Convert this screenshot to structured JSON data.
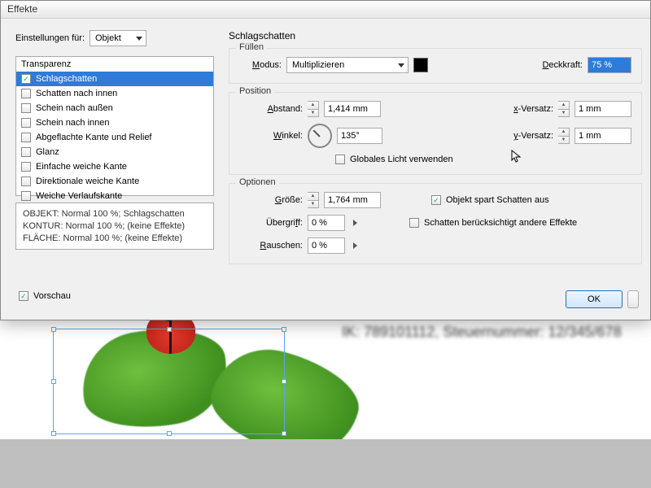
{
  "dialog": {
    "title": "Effekte",
    "settings_for_label": "Einstellungen für:",
    "settings_for_value": "Objekt",
    "effects": [
      {
        "label": "Transparenz",
        "checked": false
      },
      {
        "label": "Schlagschatten",
        "checked": true,
        "selected": true
      },
      {
        "label": "Schatten nach innen",
        "checked": false
      },
      {
        "label": "Schein nach außen",
        "checked": false
      },
      {
        "label": "Schein nach innen",
        "checked": false
      },
      {
        "label": "Abgeflachte Kante und Relief",
        "checked": false
      },
      {
        "label": "Glanz",
        "checked": false
      },
      {
        "label": "Einfache weiche Kante",
        "checked": false
      },
      {
        "label": "Direktionale weiche Kante",
        "checked": false
      },
      {
        "label": "Weiche Verlaufskante",
        "checked": false
      }
    ],
    "summary": {
      "line1": "OBJEKT: Normal 100 %; Schlagschatten",
      "line2": "KONTUR: Normal 100 %; (keine Effekte)",
      "line3": "FLÄCHE: Normal 100 %; (keine Effekte)"
    },
    "right": {
      "heading": "Schlagschatten",
      "fill": {
        "legend": "Füllen",
        "mode_label": "Modus:",
        "mode_value": "Multiplizieren",
        "opacity_label": "Deckkraft:",
        "opacity_value": "75 %"
      },
      "position": {
        "legend": "Position",
        "distance_label": "Abstand:",
        "distance_value": "1,414 mm",
        "angle_label": "Winkel:",
        "angle_value": "135°",
        "xoffset_label": "x-Versatz:",
        "xoffset_value": "1 mm",
        "yoffset_label": "y-Versatz:",
        "yoffset_value": "1 mm",
        "global_light_label": "Globales Licht verwenden"
      },
      "options": {
        "legend": "Optionen",
        "size_label": "Größe:",
        "size_value": "1,764 mm",
        "spread_label": "Übergriff:",
        "spread_value": "0 %",
        "noise_label": "Rauschen:",
        "noise_value": "0 %",
        "knockout_label": "Objekt spart Schatten aus",
        "honors_label": "Schatten berücksichtigt andere Effekte"
      }
    },
    "preview_label": "Vorschau",
    "ok_label": "OK"
  },
  "doc": {
    "blurtext": "IK: 789101112, Steuernummer: 12/345/678"
  }
}
